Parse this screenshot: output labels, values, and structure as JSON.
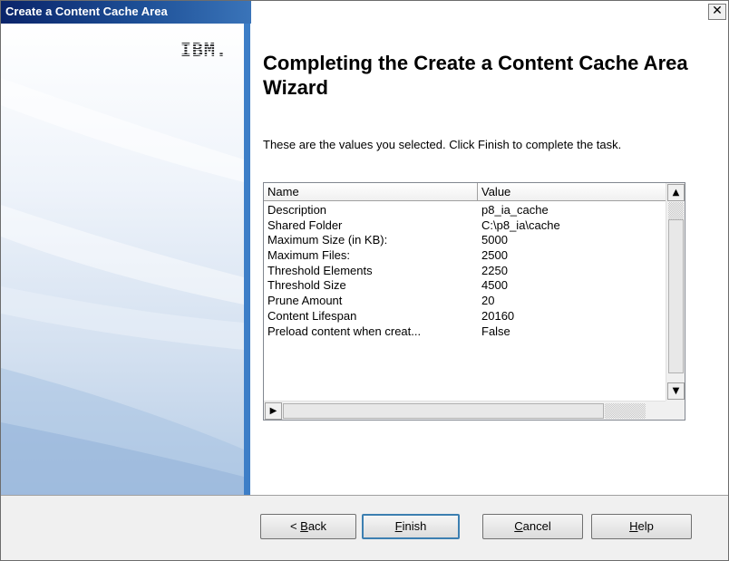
{
  "window": {
    "title": "Create a Content Cache Area",
    "close_glyph": "✕"
  },
  "banner": {
    "logo_text": "IBM."
  },
  "main": {
    "heading": "Completing the Create a Content Cache Area Wizard",
    "description": "These are the values you selected. Click Finish to complete the task."
  },
  "list": {
    "columns": [
      "Name",
      "Value"
    ],
    "rows": [
      [
        "Description",
        "p8_ia_cache"
      ],
      [
        "Shared Folder",
        "C:\\p8_ia\\cache"
      ],
      [
        "Maximum Size (in KB):",
        "5000"
      ],
      [
        "Maximum Files:",
        "2500"
      ],
      [
        "Threshold Elements",
        "2250"
      ],
      [
        "Threshold Size",
        "4500"
      ],
      [
        "Prune Amount",
        "20"
      ],
      [
        "Content Lifespan",
        "20160"
      ],
      [
        "Preload content when creat...",
        "False"
      ]
    ],
    "scroll_up_icon": "▲",
    "scroll_down_icon": "▼",
    "scroll_left_icon": "◀",
    "scroll_right_icon": "▶"
  },
  "buttons": {
    "back_prefix": "< ",
    "back_key": "B",
    "back_rest": "ack",
    "finish_key": "F",
    "finish_rest": "inish",
    "cancel_key": "C",
    "cancel_rest": "ancel",
    "help_key": "H",
    "help_rest": "elp"
  },
  "colors": {
    "title_bar": "#0a246a",
    "banner_edge": "#3d7ec7",
    "default_button_border": "#3c7fb1"
  }
}
